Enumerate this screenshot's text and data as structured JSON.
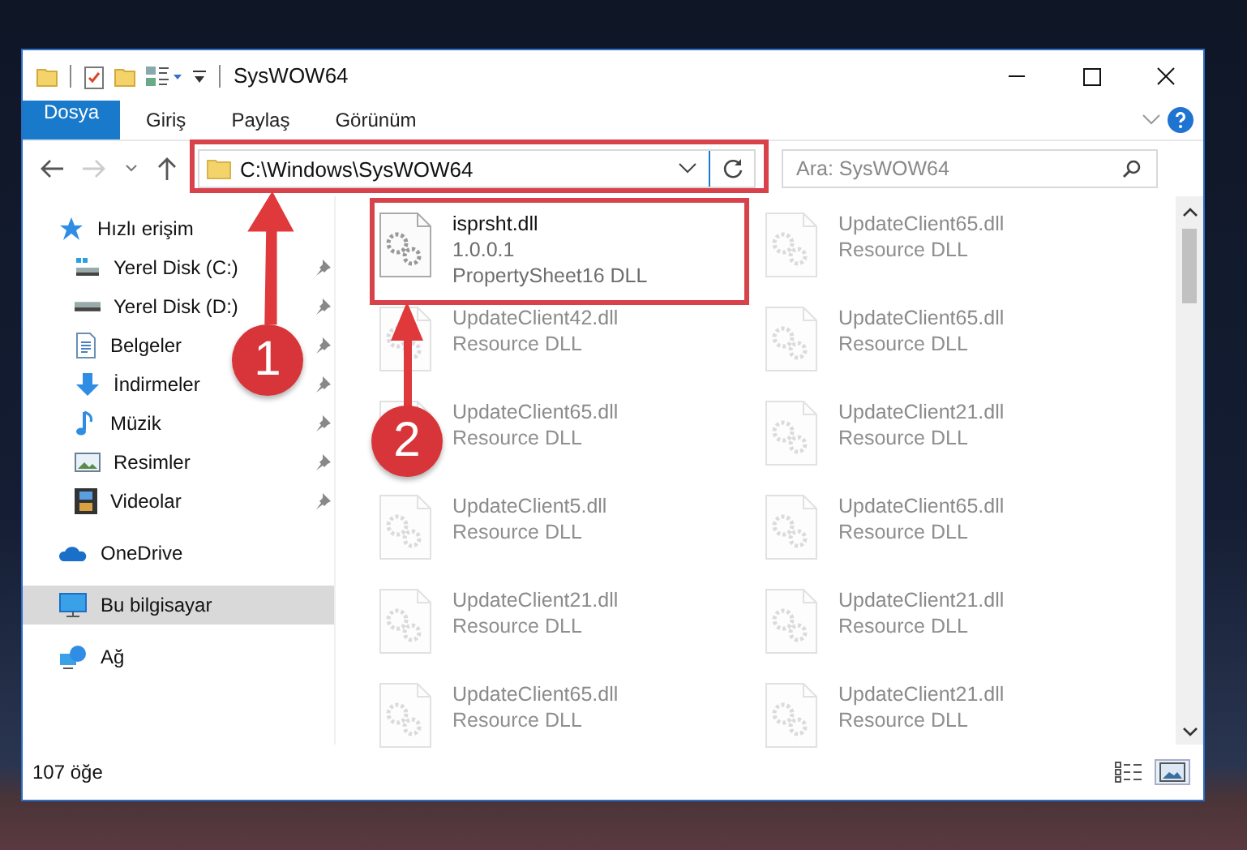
{
  "window": {
    "title": "SysWOW64"
  },
  "ribbon_tabs": [
    {
      "label": "Dosya",
      "kind": "file",
      "selected": false
    },
    {
      "label": "Giriş",
      "kind": "tab",
      "selected": false
    },
    {
      "label": "Paylaş",
      "kind": "tab",
      "selected": false
    },
    {
      "label": "Görünüm",
      "kind": "tab",
      "selected": false
    }
  ],
  "address": {
    "path": "C:\\Windows\\SysWOW64"
  },
  "search": {
    "placeholder": "Ara: SysWOW64"
  },
  "sidebar": {
    "items": [
      {
        "label": "Hızlı erişim",
        "selected": false,
        "children": [
          {
            "label": "Yerel Disk (C:)",
            "pinned": true,
            "selected": false
          },
          {
            "label": "Yerel Disk (D:)",
            "pinned": true,
            "selected": false
          },
          {
            "label": "Belgeler",
            "pinned": true,
            "selected": false
          },
          {
            "label": "İndirmeler",
            "pinned": true,
            "selected": false
          },
          {
            "label": "Müzik",
            "pinned": true,
            "selected": false
          },
          {
            "label": "Resimler",
            "pinned": true,
            "selected": false
          },
          {
            "label": "Videolar",
            "pinned": true,
            "selected": false
          }
        ]
      },
      {
        "label": "OneDrive",
        "selected": false
      },
      {
        "label": "Bu bilgisayar",
        "selected": true
      },
      {
        "label": "Ağ",
        "selected": false
      }
    ]
  },
  "files": [
    {
      "name": "isprsht.dll",
      "version": "1.0.0.1",
      "description": "PropertySheet16 DLL",
      "blurred": false
    },
    {
      "name": "UpdateClient65.dll",
      "description": "Resource DLL",
      "blurred": true
    },
    {
      "name": "UpdateClient42.dll",
      "description": "Resource DLL",
      "blurred": true
    },
    {
      "name": "UpdateClient65.dll",
      "description": "Resource DLL",
      "blurred": true
    },
    {
      "name": "UpdateClient65.dll",
      "description": "Resource DLL",
      "blurred": true
    },
    {
      "name": "UpdateClient21.dll",
      "description": "Resource DLL",
      "blurred": true
    },
    {
      "name": "UpdateClient5.dll",
      "description": "Resource DLL",
      "blurred": true
    },
    {
      "name": "UpdateClient65.dll",
      "description": "Resource DLL",
      "blurred": true
    },
    {
      "name": "UpdateClient21.dll",
      "description": "Resource DLL",
      "blurred": true
    },
    {
      "name": "UpdateClient21.dll",
      "description": "Resource DLL",
      "blurred": true
    },
    {
      "name": "UpdateClient65.dll",
      "description": "Resource DLL",
      "blurred": true
    },
    {
      "name": "UpdateClient21.dll",
      "description": "Resource DLL",
      "blurred": true
    }
  ],
  "status_bar": {
    "item_count": "107 öğe"
  },
  "view_buttons": [
    {
      "kind": "details",
      "selected": false
    },
    {
      "kind": "large-icons",
      "selected": true
    }
  ],
  "annotations": [
    {
      "number": "1"
    },
    {
      "number": "2"
    }
  ]
}
